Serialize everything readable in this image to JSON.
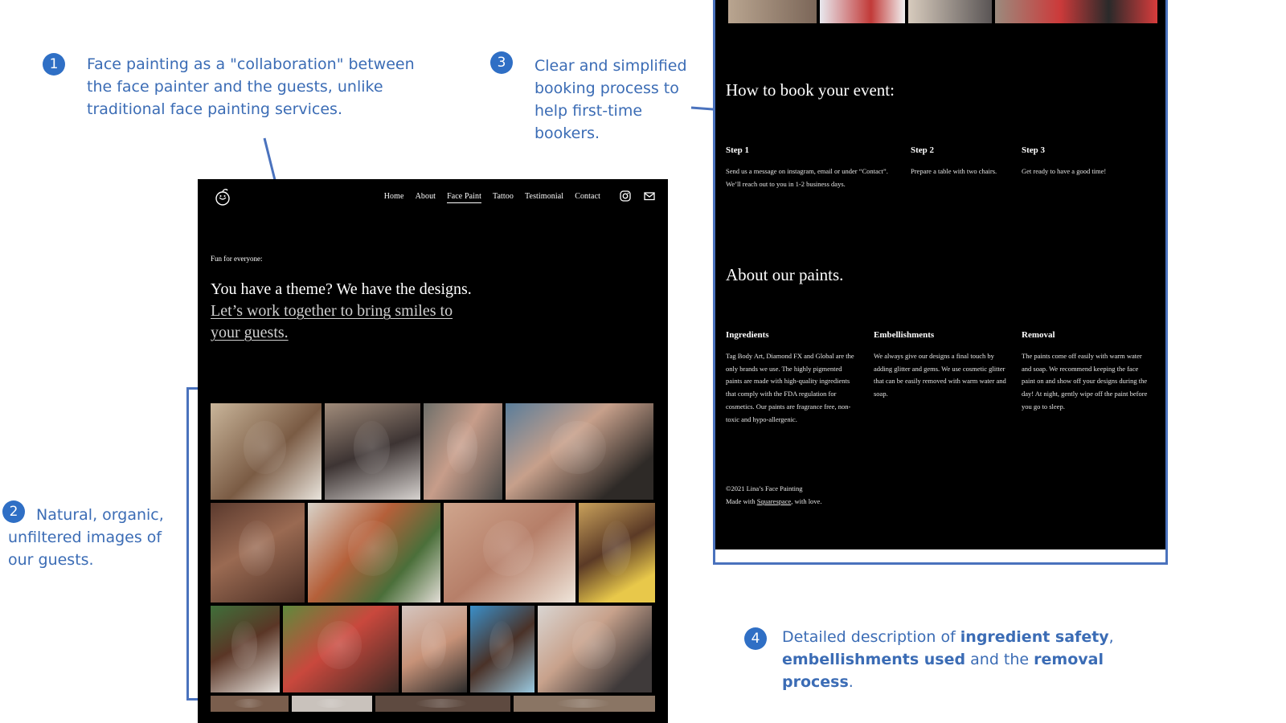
{
  "annotations": {
    "a1": {
      "num": "1",
      "text": "Face painting as a \"collaboration\" between the face painter and the guests, unlike traditional face painting services."
    },
    "a2": {
      "num": "2",
      "text": "Natural, organic, unfiltered images of our guests."
    },
    "a3": {
      "num": "3",
      "text": "Clear and simplified booking process to help first-time bookers."
    },
    "a4": {
      "num": "4",
      "t1": "Detailed description of ",
      "b1": "ingredient safety",
      "t2": ",",
      "b2": "embellishments used",
      "t3": " and the ",
      "b3": "removal process",
      "t4": "."
    }
  },
  "left_page": {
    "nav": [
      "Home",
      "About",
      "Face Paint",
      "Tattoo",
      "Testimonial",
      "Contact"
    ],
    "active_nav": "Face Paint",
    "icons": [
      "instagram-icon",
      "mail-icon"
    ],
    "eyebrow": "Fun for everyone:",
    "headline_plain": "You have a theme? We have the designs. ",
    "headline_link": "Let’s work together to bring smiles to your guests."
  },
  "right_page": {
    "book_heading": "How to book your event:",
    "steps": [
      {
        "title": "Step 1",
        "text": "Send us a message on instagram, email or under “Contact”. We’ll reach out to you in 1-2 business days."
      },
      {
        "title": "Step 2",
        "text": "Prepare a table with two chairs."
      },
      {
        "title": "Step 3",
        "text": "Get ready to have a good time!"
      }
    ],
    "paints_heading": "About our paints.",
    "columns": [
      {
        "title": "Ingredients",
        "text": "Tag Body Art, Diamond FX and Global are the only brands we use. The highly pigmented paints are made with high-quality ingredients that comply with the FDA regulation for cosmetics. Our paints are fragrance free, non-toxic and hypo-allergenic."
      },
      {
        "title": "Embellishments",
        "text": "We always give our designs a final touch by adding glitter and gems. We use cosmetic glitter that can be easily removed with warm water and soap."
      },
      {
        "title": "Removal",
        "text": "The paints come off easily with warm water and soap. We recommend keeping the face paint on and show off your designs during the day! At night, gently wipe off the paint before you go to sleep."
      }
    ],
    "footer": {
      "line1": "©2021 Lina’s Face Painting",
      "made": "Made with ",
      "link": "Squarespace",
      "tail": ", with love."
    }
  }
}
